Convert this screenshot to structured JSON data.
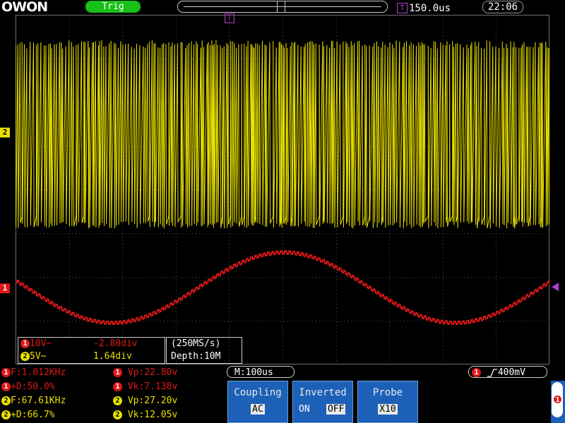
{
  "brand": "OWON",
  "header": {
    "trig_status": "Trig",
    "trigger_position_icon": "T",
    "trigger_position": "150.0us",
    "clock": "22:06"
  },
  "markers": {
    "ch2_label": "2",
    "ch1_label": "1",
    "trigger_icon": "T"
  },
  "channels": [
    {
      "id": "1",
      "volts_div": "10V~",
      "offset": "-2.80div",
      "color": "#e01818"
    },
    {
      "id": "2",
      "volts_div": "5V~",
      "offset": "1.64div",
      "color": "#e8e000"
    }
  ],
  "acquisition": {
    "sample_rate": "(250MS/s)",
    "depth": "Depth:10M"
  },
  "measurements": {
    "ch1_freq": "F:1.012KHz",
    "ch1_duty": "+D:50.0%",
    "ch1_vp": "Vp:22.80v",
    "ch1_vk": "Vk:7.138v",
    "ch2_freq": "F:67.61KHz",
    "ch2_duty": "+D:66.7%",
    "ch2_vp": "Vp:27.20v",
    "ch2_vk": "Vk:12.05v"
  },
  "timebase": "M:100us",
  "trigger": {
    "channel": "1",
    "edge_icon": "rising-edge-icon",
    "level": "400mV"
  },
  "menu": {
    "coupling": {
      "title": "Coupling",
      "value": "AC"
    },
    "inverted": {
      "title": "Inverted",
      "on": "ON",
      "off": "OFF",
      "selected": "OFF"
    },
    "probe": {
      "title": "Probe",
      "value": "X10"
    }
  },
  "scroll_indicator": "1",
  "colors": {
    "ch1": "#e01818",
    "ch2": "#e8e000",
    "trigger": "#b040d0",
    "menu": "#1c60b8",
    "trig_badge": "#18c018"
  }
}
